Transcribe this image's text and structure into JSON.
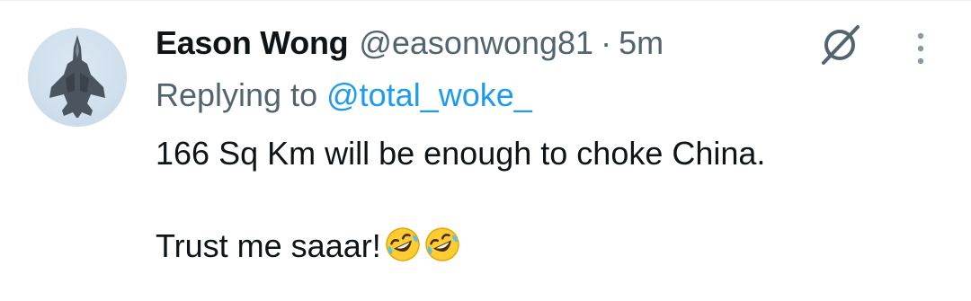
{
  "tweet": {
    "author": {
      "display_name": "Eason Wong",
      "handle": "@easonwong81",
      "avatar_icon": "fighter-jet-avatar"
    },
    "separator": "·",
    "time": "5m",
    "reply": {
      "prefix": "Replying to",
      "mention": "@total_woke_"
    },
    "text_line_1": "166 Sq Km will be enough to choke China.",
    "text_line_2": "Trust me saaar!",
    "emojis": [
      "rolling-on-floor-laughing",
      "rolling-on-floor-laughing"
    ]
  },
  "actions": {
    "grok_icon": "grok-icon",
    "more_icon": "more-options-icon"
  },
  "colors": {
    "text_primary": "#0f1419",
    "text_secondary": "#536471",
    "link": "#1d9bf0"
  }
}
